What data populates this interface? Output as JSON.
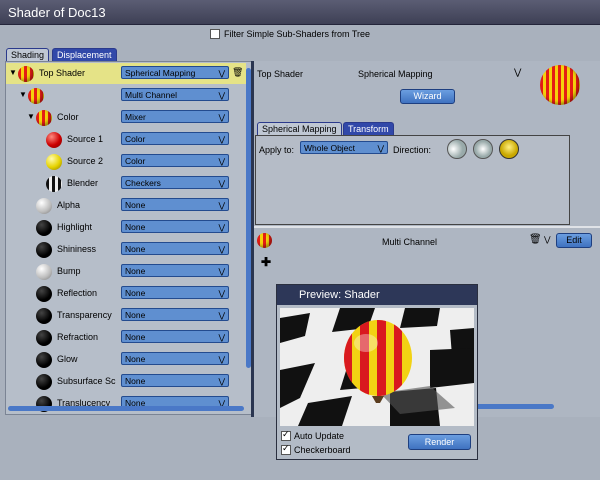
{
  "window": {
    "title": "Shader of Doc13"
  },
  "filter": {
    "label": "Filter Simple Sub-Shaders from Tree",
    "checked": false
  },
  "tabs": [
    {
      "label": "Shading",
      "active": true
    },
    {
      "label": "Displacement",
      "active": false
    }
  ],
  "tree": [
    {
      "label": "Top Shader",
      "ball": "stripes",
      "value": "Spherical Mapping"
    },
    {
      "label": "",
      "ball": "stripes",
      "value": "Multi Channel"
    },
    {
      "label": "Color",
      "ball": "stripes",
      "value": "Mixer"
    },
    {
      "label": "Source 1",
      "ball": "red",
      "value": "Color"
    },
    {
      "label": "Source 2",
      "ball": "yellow",
      "value": "Color"
    },
    {
      "label": "Blender",
      "ball": "checker",
      "value": "Checkers"
    },
    {
      "label": "Alpha",
      "ball": "white",
      "value": "None"
    },
    {
      "label": "Highlight",
      "ball": "black",
      "value": "None"
    },
    {
      "label": "Shininess",
      "ball": "black",
      "value": "None"
    },
    {
      "label": "Bump",
      "ball": "white",
      "value": "None"
    },
    {
      "label": "Reflection",
      "ball": "black",
      "value": "None"
    },
    {
      "label": "Transparency",
      "ball": "black",
      "value": "None"
    },
    {
      "label": "Refraction",
      "ball": "black",
      "value": "None"
    },
    {
      "label": "Glow",
      "ball": "black",
      "value": "None"
    },
    {
      "label": "Subsurface Sc",
      "ball": "black",
      "value": "None"
    },
    {
      "label": "Translucency",
      "ball": "black",
      "value": "None"
    }
  ],
  "detail": {
    "node_label": "Top Shader",
    "node_type": "Spherical Mapping",
    "wizard_label": "Wizard",
    "subtabs": [
      {
        "label": "Spherical Mapping",
        "active": true
      },
      {
        "label": "Transform",
        "active": false
      }
    ],
    "apply_to_label": "Apply to:",
    "apply_to_value": "Whole Object",
    "direction_label": "Direction:",
    "channel_label": "Multi Channel",
    "edit_label": "Edit"
  },
  "preview": {
    "title": "Preview: Shader",
    "auto_update_label": "Auto Update",
    "auto_update_checked": true,
    "checkerboard_label": "Checkerboard",
    "checkerboard_checked": true,
    "render_label": "Render"
  },
  "colors": {
    "accent_blue": "#4a78c7",
    "selected_row": "#e5e387",
    "title_bar": "#3e4055"
  }
}
